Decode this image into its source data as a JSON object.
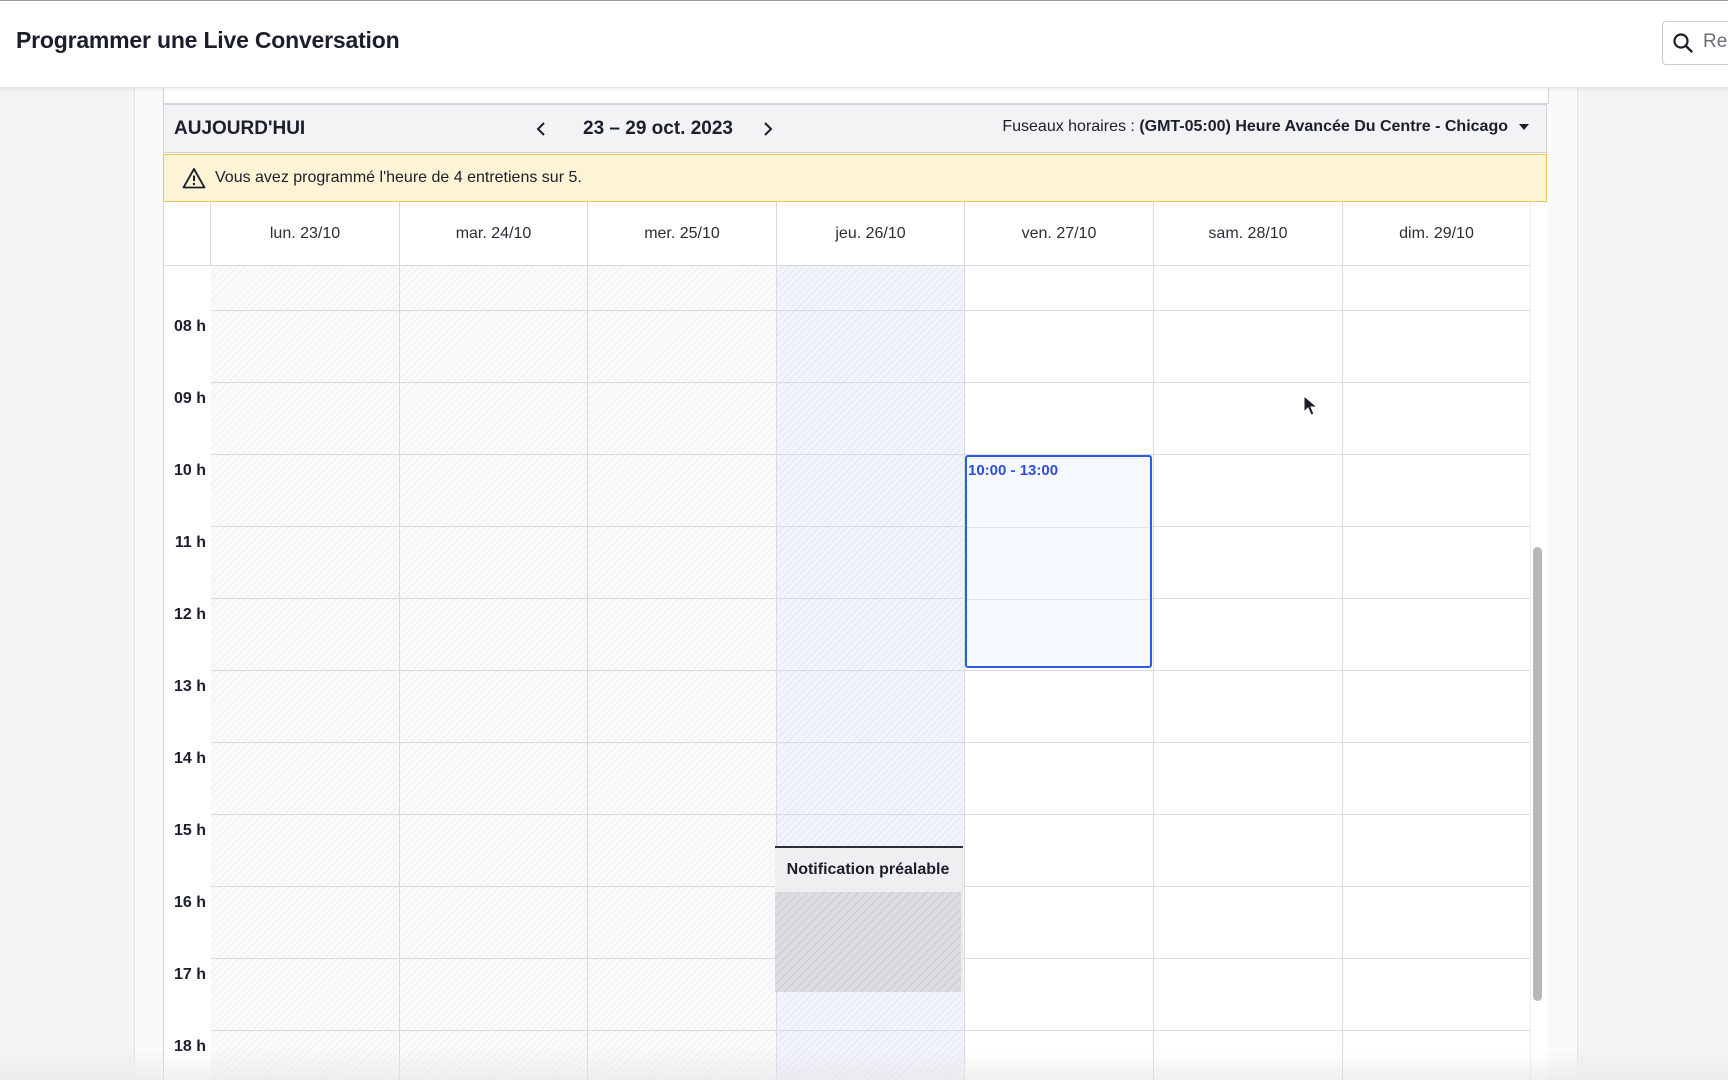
{
  "header": {
    "title": "Programmer une Live Conversation",
    "search_placeholder": "Rec"
  },
  "toolbar": {
    "today_label": "AUJOURD'HUI",
    "date_range": "23 – 29 oct. 2023",
    "timezone_label": "Fuseaux horaires :",
    "timezone_value": "(GMT-05:00) Heure Avancée Du Centre - Chicago"
  },
  "alert": {
    "text": "Vous avez programmé l'heure de 4 entretiens sur 5."
  },
  "calendar": {
    "days": [
      "lun. 23/10",
      "mar. 24/10",
      "mer. 25/10",
      "jeu. 26/10",
      "ven. 27/10",
      "sam. 28/10",
      "dim. 29/10"
    ],
    "hours": [
      "08 h",
      "09 h",
      "10 h",
      "11 h",
      "12 h",
      "13 h",
      "14 h",
      "15 h",
      "16 h",
      "17 h",
      "18 h"
    ],
    "unavailable_days": [
      "lun. 23/10",
      "mar. 24/10",
      "mer. 25/10",
      "jeu. 26/10"
    ],
    "selected_slot": {
      "day": "ven. 27/10",
      "label": "10:00 - 13:00"
    },
    "notice_block": {
      "day": "jeu. 26/10",
      "label": "Notification préalable"
    }
  },
  "icons": {
    "search": "search-icon",
    "prev": "chevron-left-icon",
    "next": "chevron-right-icon",
    "dropdown": "caret-down-icon",
    "warning": "warning-triangle-icon"
  },
  "colors": {
    "accent": "#2d5be3",
    "alert_bg": "#fdf4d6",
    "alert_border": "#ecc95c"
  }
}
